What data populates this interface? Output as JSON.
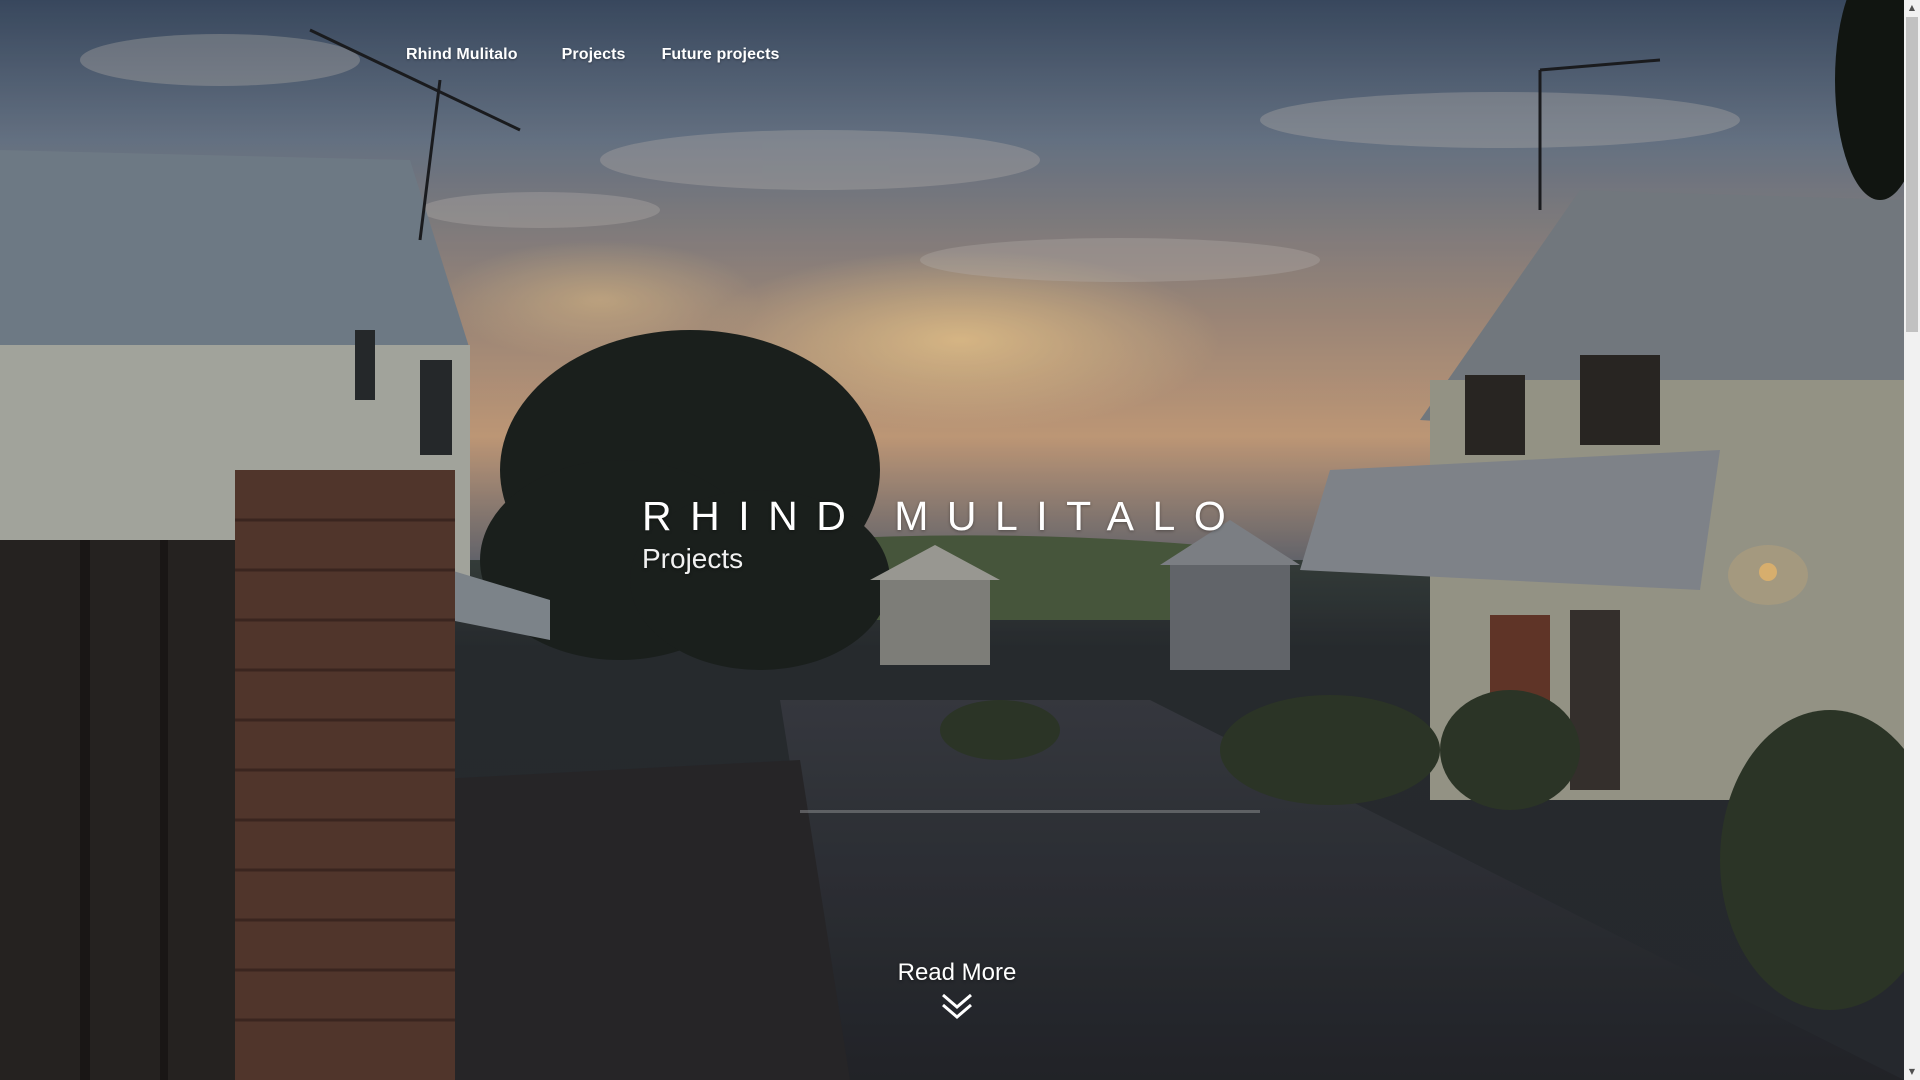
{
  "nav": {
    "items": [
      {
        "label": "Rhind Mulitalo"
      },
      {
        "label": "Projects"
      },
      {
        "label": "Future projects"
      }
    ]
  },
  "hero": {
    "title": "RHIND MULITALO",
    "subtitle": "Projects",
    "read_more": "Read More",
    "read_more_icon": "double-chevron-down-icon",
    "background_description_icon": "street-photo"
  },
  "colors": {
    "text": "#ffffff",
    "sky_top": "#4a5a72",
    "sunset": "#c7a183",
    "road": "#2a2d33",
    "scrollbar_track": "#f1f1f1",
    "scrollbar_thumb": "#c1c1c1"
  }
}
